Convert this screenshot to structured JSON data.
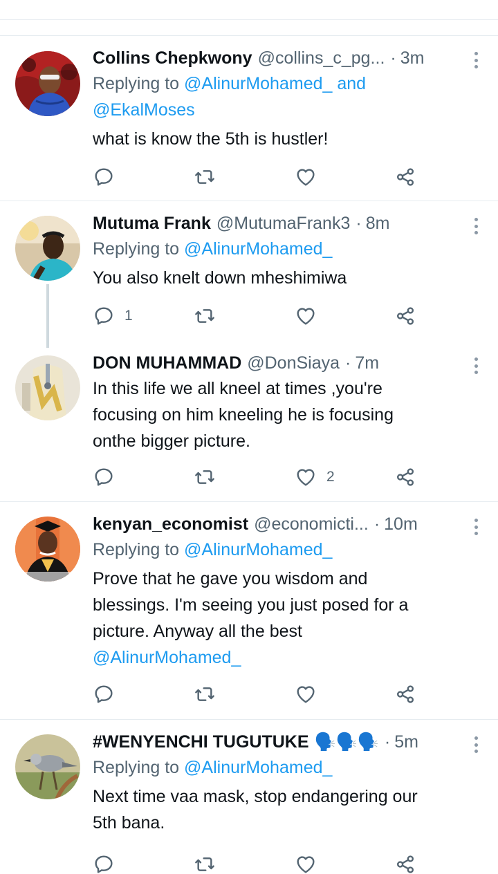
{
  "tweets": [
    {
      "name": "Collins Chepkwony",
      "handle": "@collins_c_pg...",
      "time": "3m",
      "replying_prefix": "Replying to",
      "replying_mentions": "@AlinurMohamed_ and",
      "replying_mentions2": "@EkalMoses",
      "text": "what is know the 5th is hustler!",
      "reply_count": "",
      "like_count": ""
    },
    {
      "name": "Mutuma Frank",
      "handle": "@MutumaFrank3",
      "time": "8m",
      "replying_prefix": "Replying to",
      "replying_mentions": "@AlinurMohamed_",
      "text": "You also knelt down mheshimiwa",
      "reply_count": "1",
      "like_count": ""
    },
    {
      "name": "DON MUHAMMAD",
      "handle": "@DonSiaya",
      "time": "7m",
      "text_lines": [
        "In this life we all kneel at times ,you're",
        "focusing on him kneeling he is focusing",
        "onthe bigger picture."
      ],
      "reply_count": "",
      "like_count": "2"
    },
    {
      "name": "kenyan_economist",
      "handle": "@economicti...",
      "time": "10m",
      "replying_prefix": "Replying to",
      "replying_mentions": "@AlinurMohamed_",
      "text_lines": [
        "Prove that he gave you wisdom and",
        "blessings. I'm seeing you just posed for a",
        "picture. Anyway all the best"
      ],
      "text_mention": "@AlinurMohamed_",
      "reply_count": "",
      "like_count": ""
    },
    {
      "name": "#WENYENCHI TUGUTUKE",
      "name_emoji": "🗣️🗣️🗣️",
      "handle": "",
      "time": "5m",
      "replying_prefix": "Replying to",
      "replying_mentions": "@AlinurMohamed_",
      "text_lines": [
        "Next time vaa mask, stop endangering our",
        "5th bana."
      ],
      "reply_count": "",
      "like_count": ""
    }
  ],
  "icons": {
    "reply": "reply-icon",
    "retweet": "retweet-icon",
    "like": "heart-icon",
    "share": "share-icon",
    "more": "more-vertical-icon"
  },
  "colors": {
    "link": "#1d9bf0",
    "secondary": "#536471",
    "separator": "#e6ecf0",
    "icon": "#536471"
  }
}
